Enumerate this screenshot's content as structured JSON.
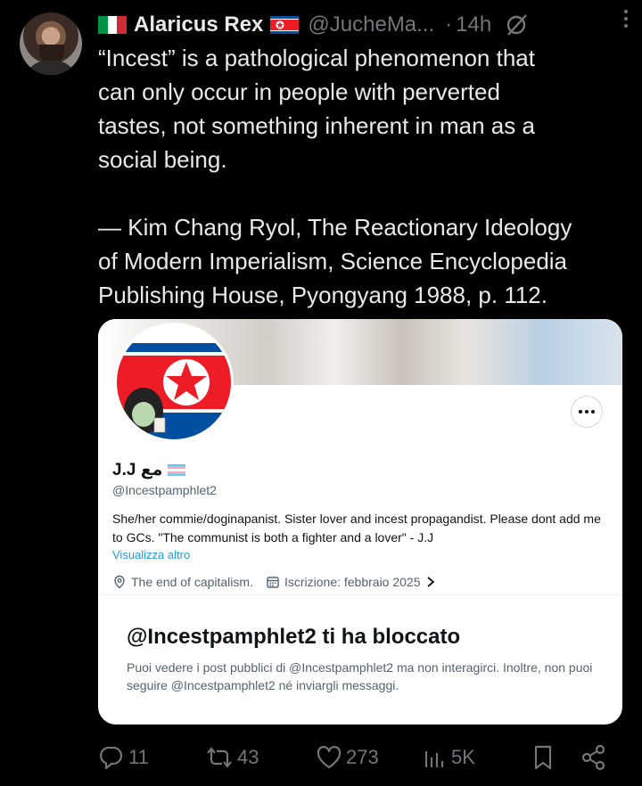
{
  "tweet": {
    "author_name": "Alaricus Rex",
    "handle": "@JucheMa...",
    "separator": "·",
    "time": "14h",
    "text": "“Incest” is a pathological phenomenon that\ncan only occur in people with perverted\ntastes, not something inherent in man as a\nsocial being.\n\n— Kim Chang Ryol, The Reactionary Ideology\nof Modern Imperialism, Science Encyclopedia\nPublishing House, Pyongyang 1988, p. 112."
  },
  "card": {
    "display_name": "J.J ﻣﻊ",
    "handle": "@Incestpamphlet2",
    "bio": "She/her commie/doginapanist. Sister lover and incest propagandist. Please dont add me to GCs. \"The communist is both a fighter and a lover\" - J.J",
    "see_more": "Visualizza altro",
    "location": "The end of capitalism.",
    "joined": "Iscrizione: febbraio 2025",
    "blocked_title": "@Incestpamphlet2 ti ha bloccato",
    "blocked_desc": "Puoi vedere i post pubblici di @Incestpamphlet2 ma non interagirci. Inoltre, non puoi seguire @Incestpamphlet2 né inviargli messaggi."
  },
  "actions": {
    "replies": "11",
    "reposts": "43",
    "likes": "273",
    "views": "5K"
  },
  "colors": {
    "background": "#000000",
    "text": "#e7e9ea",
    "muted": "#71767b",
    "link": "#1d9bf0"
  },
  "icons": [
    "italy-flag-icon",
    "north-korea-flag-icon",
    "grok-icon",
    "more-icon",
    "ellipsis-icon",
    "trans-flag-icon",
    "location-icon",
    "calendar-icon",
    "chevron-right-icon",
    "reply-icon",
    "repost-icon",
    "like-icon",
    "views-icon",
    "bookmark-icon",
    "share-icon"
  ]
}
